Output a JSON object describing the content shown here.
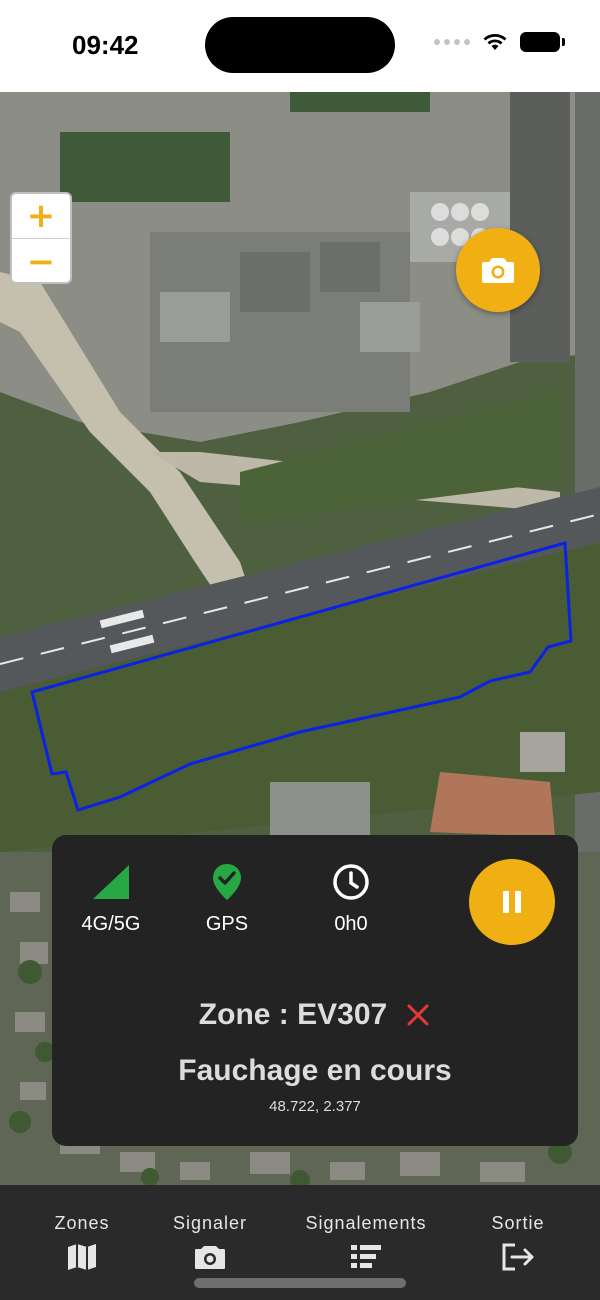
{
  "status_bar": {
    "time": "09:42",
    "icons": [
      "cellular-dots-icon",
      "wifi-icon",
      "battery-icon"
    ]
  },
  "map": {
    "zoom_in_label": "+",
    "zoom_out_label": "−",
    "camera_button_icon": "camera-icon",
    "zone_outline_color": "#0a22e6"
  },
  "panel": {
    "stats": [
      {
        "icon": "signal-strength-icon",
        "label": "4G/5G",
        "color": "#27a844"
      },
      {
        "icon": "gps-check-pin-icon",
        "label": "GPS",
        "color": "#27a844"
      },
      {
        "icon": "clock-icon",
        "label": "0h0",
        "color": "#ffffff"
      }
    ],
    "pause_icon": "pause-icon",
    "zone_label": "Zone : EV307",
    "status": "Fauchage en cours",
    "coords": "48.722, 2.377",
    "close_color": "#e53935"
  },
  "bottom_nav": {
    "items": [
      {
        "label": "Zones",
        "icon": "map-icon"
      },
      {
        "label": "Signaler",
        "icon": "camera-icon"
      },
      {
        "label": "Signalements",
        "icon": "list-icon"
      },
      {
        "label": "Sortie",
        "icon": "logout-icon"
      }
    ]
  },
  "colors": {
    "accent": "#f0b014",
    "panel_bg": "#232323",
    "nav_bg": "#2a2a2a"
  }
}
